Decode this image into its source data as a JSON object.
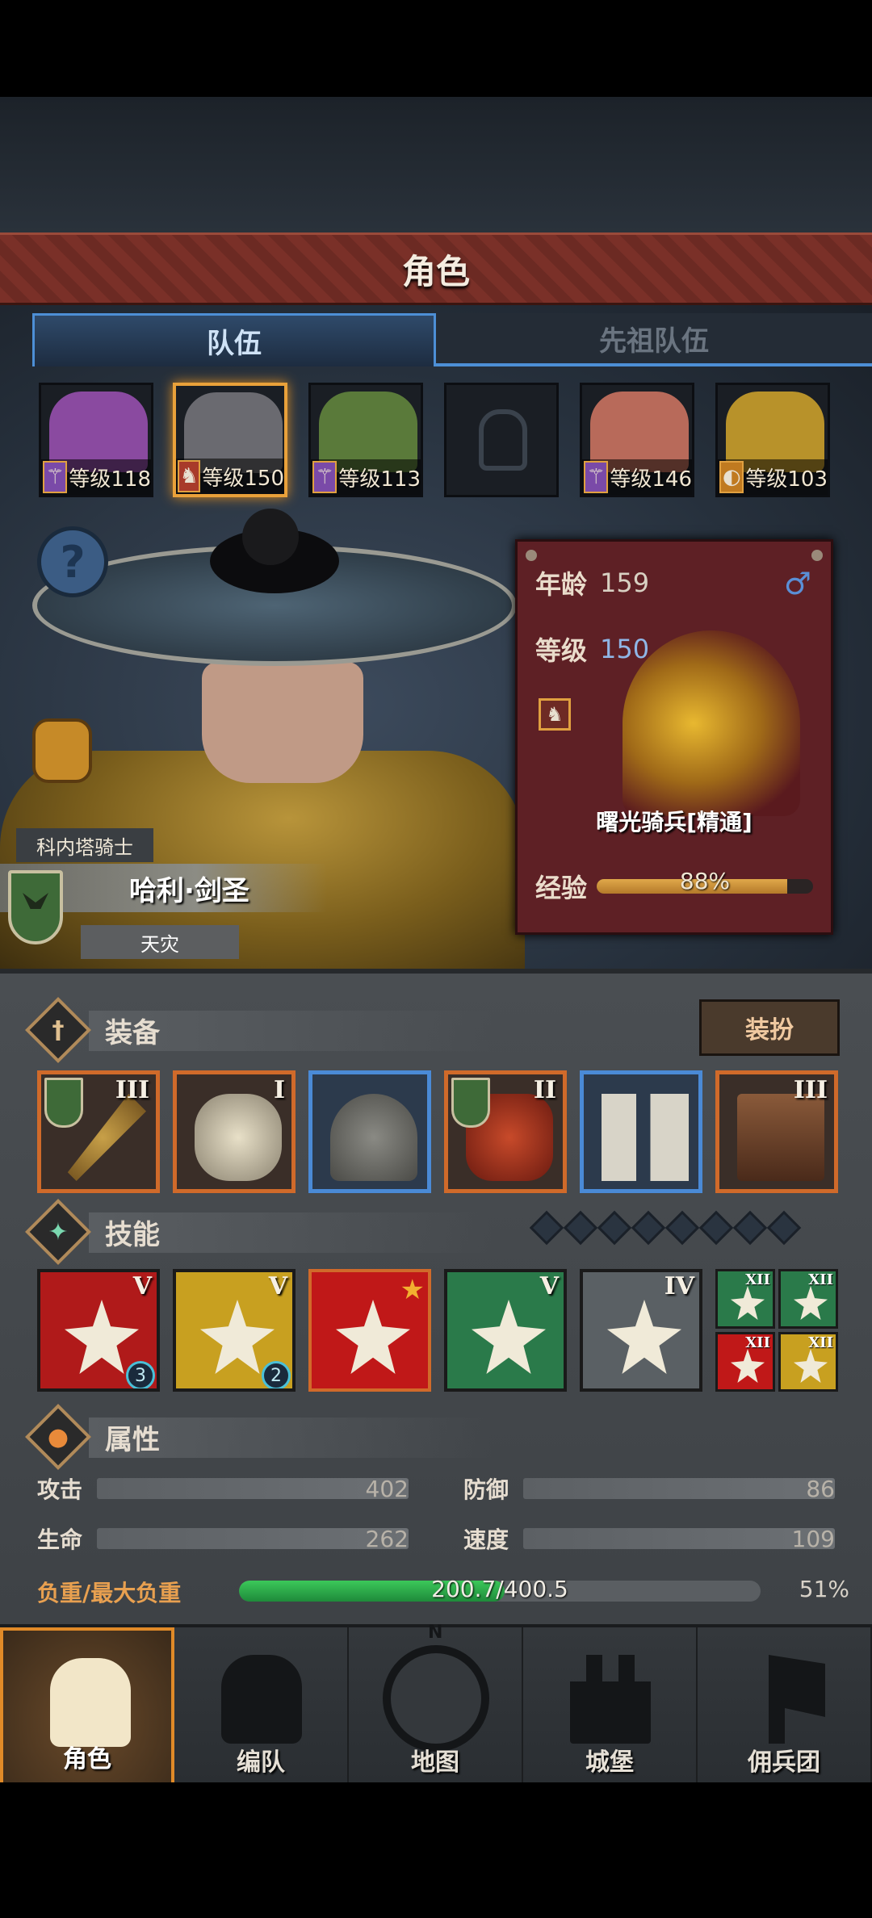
{
  "header": {
    "title": "角色"
  },
  "tabs": [
    {
      "label": "队伍",
      "active": true
    },
    {
      "label": "先祖队伍",
      "active": false
    }
  ],
  "party": [
    {
      "level_text": "等级118",
      "class_icon": "staff-icon",
      "class_color": "#7a4aa8",
      "face_color": "#8a4aa0"
    },
    {
      "level_text": "等级150",
      "class_icon": "horse-icon",
      "class_color": "#a83a2a",
      "face_color": "#6a6a70",
      "selected": true
    },
    {
      "level_text": "等级113",
      "class_icon": "staff-icon",
      "class_color": "#7a4aa8",
      "face_color": "#5a7a3a"
    },
    {
      "level_text": "",
      "empty": true
    },
    {
      "level_text": "等级146",
      "class_icon": "staff-icon",
      "class_color": "#7a4aa8",
      "face_color": "#b86a5a"
    },
    {
      "level_text": "等级103",
      "class_icon": "shield-icon",
      "class_color": "#c07a20",
      "face_color": "#b8922a"
    }
  ],
  "hero": {
    "rank": "科内塔骑士",
    "name": "哈利·剑圣",
    "faction": "天灾",
    "help": "?"
  },
  "info": {
    "age_label": "年龄",
    "age": "159",
    "level_label": "等级",
    "level": "150",
    "gender": "♂",
    "class_name": "曙光骑兵[精通]",
    "exp_label": "经验",
    "exp_pct": "88%",
    "exp_value": 0.88
  },
  "equipment": {
    "title": "装备",
    "dress_button": "装扮",
    "slots": [
      {
        "tier": "III",
        "frame": "orange",
        "flag": true,
        "item": "sword-icon"
      },
      {
        "tier": "I",
        "frame": "orange",
        "flag": false,
        "item": "shield-icon"
      },
      {
        "tier": "",
        "frame": "blue",
        "flag": false,
        "item": "helmet-icon"
      },
      {
        "tier": "II",
        "frame": "orange",
        "flag": true,
        "item": "armor-icon"
      },
      {
        "tier": "",
        "frame": "blue",
        "flag": false,
        "item": "boots-icon"
      },
      {
        "tier": "III",
        "frame": "orange",
        "flag": false,
        "item": "book-icon"
      }
    ]
  },
  "skills": {
    "title": "技能",
    "pip_count": 8,
    "main": [
      {
        "tier": "V",
        "bg": "#b01a1a",
        "badge": "3",
        "icon": "slash-icon"
      },
      {
        "tier": "V",
        "bg": "#c8a020",
        "badge": "2",
        "icon": "lance-icon"
      },
      {
        "tier": "",
        "bg": "#c01818",
        "star": true,
        "icon": "charge-icon"
      },
      {
        "tier": "V",
        "bg": "#2a7a4a",
        "icon": "burst-icon"
      },
      {
        "tier": "IV",
        "bg": "#5a6064",
        "icon": "crystal-icon"
      }
    ],
    "mini": [
      {
        "tier": "XII",
        "bg": "#2a7a4a",
        "icon": "burst-icon"
      },
      {
        "tier": "XII",
        "bg": "#2a7a4a",
        "icon": "burst-icon"
      },
      {
        "tier": "XII",
        "bg": "#c01818",
        "icon": "sword-icon"
      },
      {
        "tier": "XII",
        "bg": "#c8a020",
        "icon": "shield-icon"
      }
    ]
  },
  "attributes": {
    "title": "属性",
    "attack_label": "攻击",
    "attack": "402",
    "defense_label": "防御",
    "defense": "86",
    "hp_label": "生命",
    "hp": "262",
    "speed_label": "速度",
    "speed": "109",
    "weight_label": "负重/最大负重",
    "weight_text": "200.7/400.5",
    "weight_pct": "51%",
    "weight_value": 0.51
  },
  "nav": [
    {
      "label": "角色",
      "icon": "knight-icon",
      "active": true
    },
    {
      "label": "编队",
      "icon": "helmet-icon",
      "active": false
    },
    {
      "label": "地图",
      "icon": "compass-icon",
      "active": false,
      "compass_n": "N"
    },
    {
      "label": "城堡",
      "icon": "castle-icon",
      "active": false
    },
    {
      "label": "佣兵团",
      "icon": "banner-icon",
      "active": false
    }
  ],
  "colors": {
    "accent_orange": "#e08a28",
    "tab_blue": "#4d8fd6",
    "title_red": "#7a3028"
  }
}
